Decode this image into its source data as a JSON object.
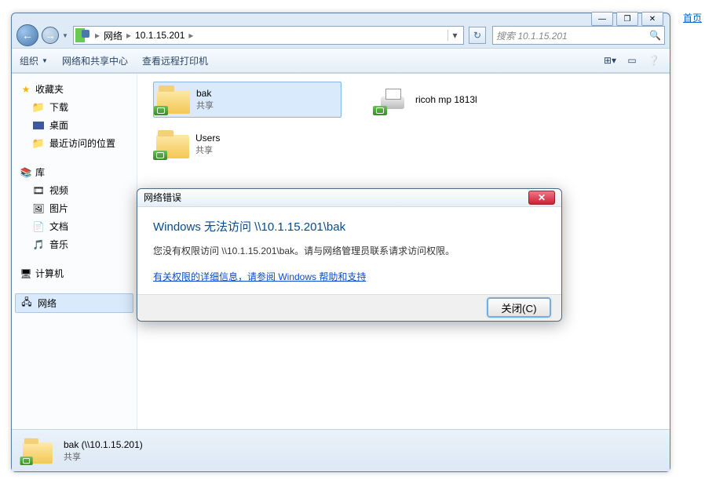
{
  "external_link": "首页",
  "window": {
    "min": "—",
    "max": "❐",
    "close": "✕"
  },
  "nav": {
    "back": "←",
    "forward": "→",
    "segments": [
      "网络",
      "10.1.15.201"
    ],
    "search_placeholder": "搜索 10.1.15.201"
  },
  "toolbar": {
    "organize": "组织",
    "network_center": "网络和共享中心",
    "view_printers": "查看远程打印机"
  },
  "sidebar": {
    "favorites": "收藏夹",
    "downloads": "下载",
    "desktop": "桌面",
    "recent": "最近访问的位置",
    "libraries": "库",
    "videos": "视频",
    "pictures": "图片",
    "documents": "文档",
    "music": "音乐",
    "computer": "计算机",
    "network": "网络"
  },
  "content": {
    "items": [
      {
        "name": "bak",
        "sub": "共享"
      },
      {
        "name": "ricoh mp 1813l",
        "sub": ""
      },
      {
        "name": "Users",
        "sub": "共享"
      }
    ]
  },
  "status": {
    "name": "bak (\\\\10.1.15.201)",
    "sub": "共享"
  },
  "dialog": {
    "title": "网络错误",
    "heading": "Windows 无法访问 \\\\10.1.15.201\\bak",
    "message": "您没有权限访问 \\\\10.1.15.201\\bak。请与网络管理员联系请求访问权限。",
    "link": "有关权限的详细信息，请参阅 Windows 帮助和支持",
    "close_btn": "关闭(C)",
    "close_x": "✕"
  }
}
